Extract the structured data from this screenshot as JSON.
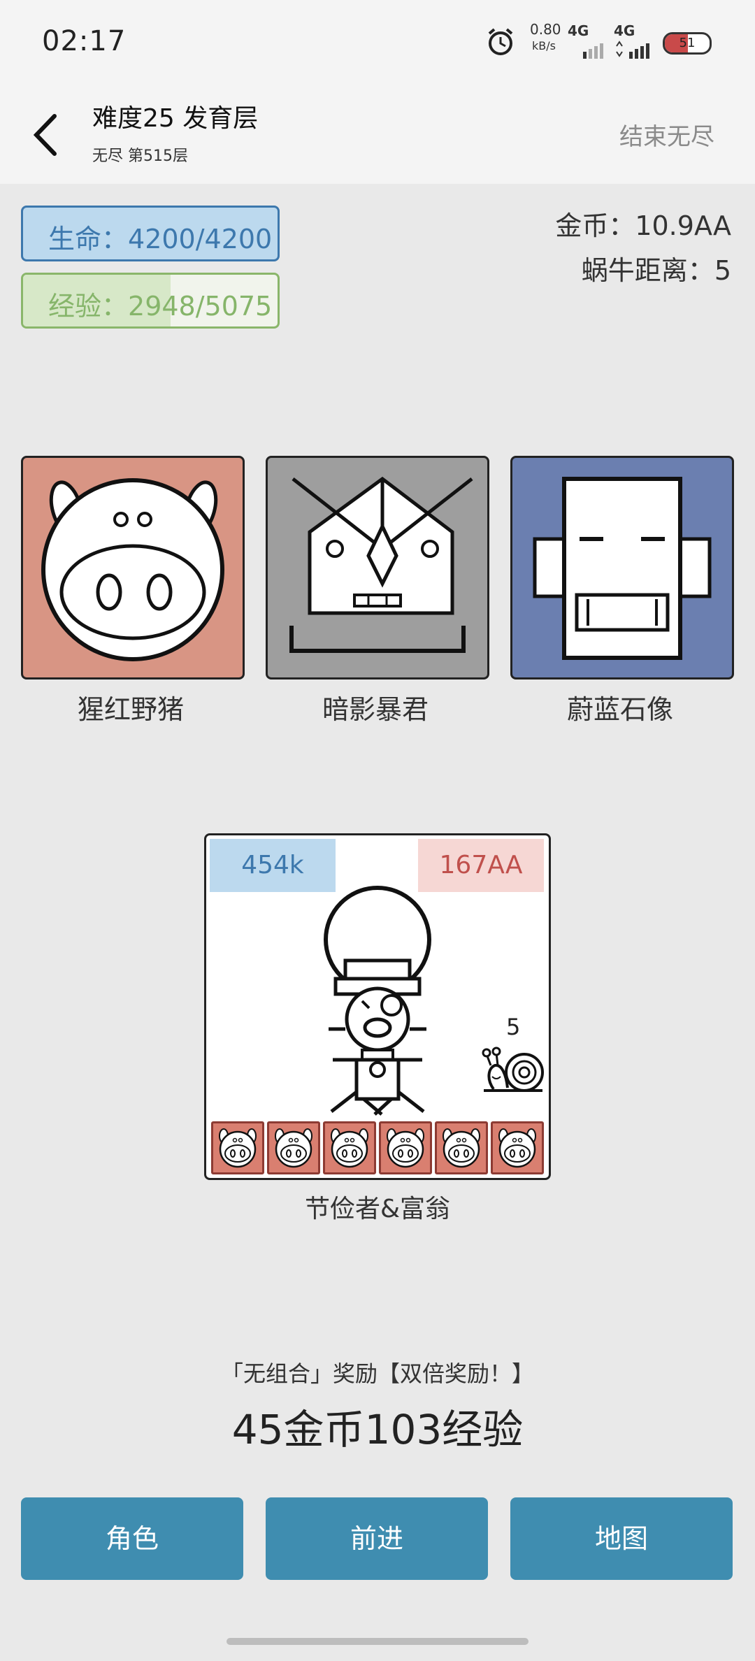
{
  "status_bar": {
    "time": "02:17",
    "net_speed": "0.80",
    "net_unit": "kB/s",
    "sig1": "4G",
    "sig2": "4G",
    "battery": "51"
  },
  "header": {
    "title": "难度25 发育层",
    "subtitle": "无尽 第515层",
    "end_button": "结束无尽"
  },
  "stats": {
    "hp_label": "生命：",
    "hp_value": "4200/4200",
    "exp_label": "经验：",
    "exp_value": "2948/5075",
    "exp_fraction": 0.58,
    "gold_label": "金币：",
    "gold_value": "10.9AA",
    "snail_label": "蜗牛距离：",
    "snail_value": "5"
  },
  "enemies": [
    {
      "name": "猩红野猪",
      "color": "#d89584",
      "icon": "boar-icon"
    },
    {
      "name": "暗影暴君",
      "color": "#9e9e9e",
      "icon": "tyrant-icon"
    },
    {
      "name": "蔚蓝石像",
      "color": "#6b7fb0",
      "icon": "statue-icon"
    }
  ],
  "player": {
    "attack": "454k",
    "damage": "167AA",
    "snail_count": "5",
    "name": "节俭者&富翁",
    "mini_pig_count": 6
  },
  "reward": {
    "line": "「无组合」奖励【双倍奖励！】",
    "amount": "45金币103经验"
  },
  "buttons": {
    "role": "角色",
    "forward": "前进",
    "map": "地图"
  },
  "colors": {
    "hp": "#3d78ad",
    "exp": "#86b56a",
    "button": "#3f8db0"
  }
}
